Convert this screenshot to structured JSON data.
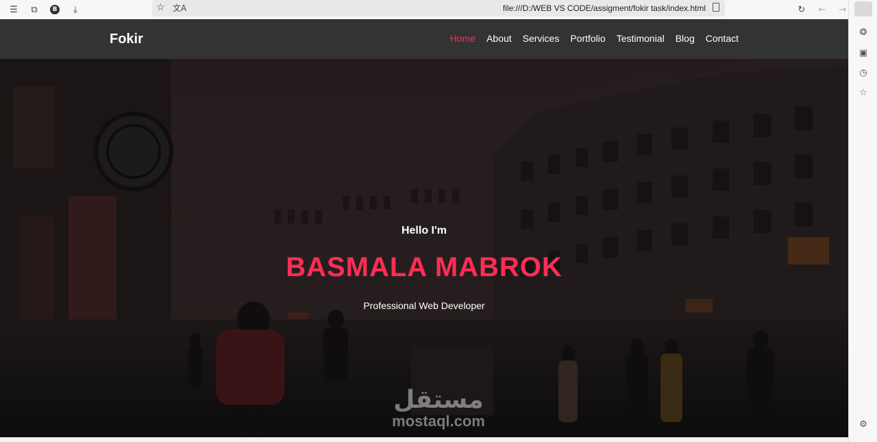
{
  "browser": {
    "url": "file:///D:/WEB VS CODE/assigment/fokir task/index.html"
  },
  "nav": {
    "brand": "Fokir",
    "items": [
      {
        "label": "Home",
        "active": true
      },
      {
        "label": "About",
        "active": false
      },
      {
        "label": "Services",
        "active": false
      },
      {
        "label": "Portfolio",
        "active": false
      },
      {
        "label": "Testimonial",
        "active": false
      },
      {
        "label": "Blog",
        "active": false
      },
      {
        "label": "Contact",
        "active": false
      }
    ]
  },
  "hero": {
    "greeting": "Hello I'm",
    "name": "BASMALA MABROK",
    "role": "Professional Web Developer"
  },
  "watermark": {
    "arabic": "مستقل",
    "latin": "mostaql.com"
  },
  "colors": {
    "accent": "#ff2d55",
    "nav_bg": "#333333"
  },
  "icons": {
    "toolbar": [
      "menu-icon",
      "extension-icon",
      "b-icon",
      "download-icon",
      "star-icon",
      "translate-icon",
      "page-info-icon",
      "reload-icon",
      "back-icon",
      "forward-icon",
      "sidebar-toggle-icon"
    ],
    "sidebar": [
      "copilot-icon",
      "collections-icon",
      "history-icon",
      "favorites-icon",
      "settings-icon"
    ]
  }
}
